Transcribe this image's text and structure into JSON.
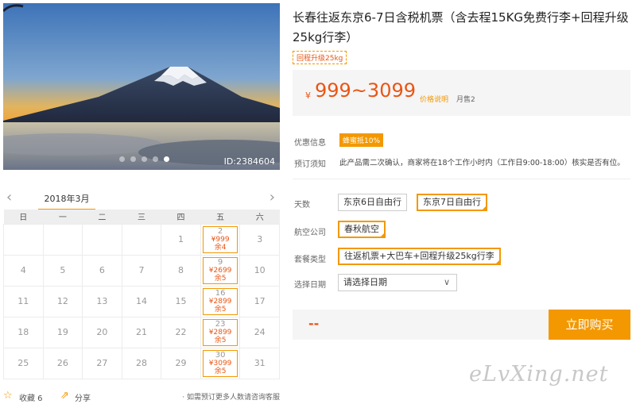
{
  "hero": {
    "image_id": "ID:2384604",
    "slide_count": 5,
    "active_slide": 5
  },
  "calendar": {
    "month": "2018年3月",
    "prev_icon": "chevron-left-icon",
    "next_icon": "chevron-right-icon",
    "weekdays": [
      "日",
      "一",
      "二",
      "三",
      "四",
      "五",
      "六"
    ],
    "weeks": [
      [
        {
          "d": ""
        },
        {
          "d": ""
        },
        {
          "d": ""
        },
        {
          "d": ""
        },
        {
          "d": "1"
        },
        {
          "d": "2",
          "p": "¥999",
          "s": "余4"
        },
        {
          "d": "3"
        }
      ],
      [
        {
          "d": "4"
        },
        {
          "d": "5"
        },
        {
          "d": "6"
        },
        {
          "d": "7"
        },
        {
          "d": "8"
        },
        {
          "d": "9",
          "p": "¥2699",
          "s": "余5"
        },
        {
          "d": "10"
        }
      ],
      [
        {
          "d": "11"
        },
        {
          "d": "12"
        },
        {
          "d": "13"
        },
        {
          "d": "14"
        },
        {
          "d": "15"
        },
        {
          "d": "16",
          "p": "¥2899",
          "s": "余5"
        },
        {
          "d": "17"
        }
      ],
      [
        {
          "d": "18"
        },
        {
          "d": "19"
        },
        {
          "d": "20"
        },
        {
          "d": "21"
        },
        {
          "d": "22"
        },
        {
          "d": "23",
          "p": "¥2899",
          "s": "余5"
        },
        {
          "d": "24"
        }
      ],
      [
        {
          "d": "25"
        },
        {
          "d": "26"
        },
        {
          "d": "27"
        },
        {
          "d": "28"
        },
        {
          "d": "29"
        },
        {
          "d": "30",
          "p": "¥3099",
          "s": "余5"
        },
        {
          "d": "31"
        }
      ]
    ]
  },
  "actions": {
    "collect_label": "收藏 6",
    "share_label": "分享",
    "note": "· 如需预订更多人数请咨询客服"
  },
  "product": {
    "title": "长春往返东京6-7日含税机票（含去程15KG免费行李+回程升级25kg行李）",
    "tag": "回程升级25kg",
    "price_symbol": "¥",
    "price": "999~3099",
    "price_note": "价格说明",
    "sold": "月售2",
    "promo_label": "优惠信息",
    "promo_badge": "蜂蜜抵10%",
    "notice_label": "预订须知",
    "notice_text": "此产品需二次确认，商家将在18个工作小时内（工作日9:00-18:00）核实是否有位。",
    "days_label": "天数",
    "days_options": [
      "东京6日自由行",
      "东京7日自由行"
    ],
    "airline_label": "航空公司",
    "airline_options": [
      "春秋航空"
    ],
    "package_label": "套餐类型",
    "package_options": [
      "往返机票+大巴车+回程升级25kg行李"
    ],
    "date_label": "选择日期",
    "date_placeholder": "请选择日期",
    "total": "--",
    "buy_label": "立即购买"
  },
  "watermark": "eLvXing.net",
  "colors": {
    "accent": "#f39800",
    "price": "#ea5514"
  }
}
